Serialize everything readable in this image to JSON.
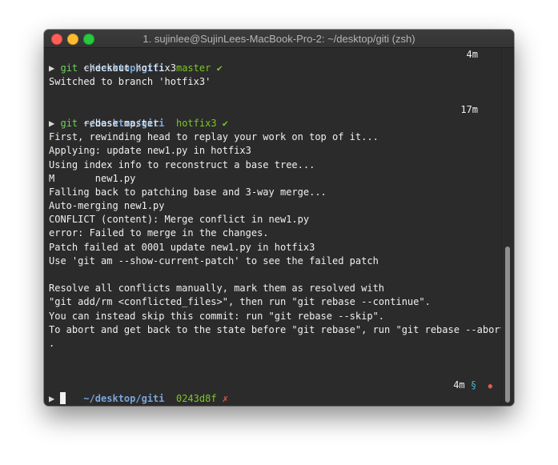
{
  "window": {
    "title": "1. sujinlee@SujinLees-MacBook-Pro-2: ~/desktop/giti (zsh)"
  },
  "prompt1": {
    "dir": "~/desktop/giti",
    "branch": "master",
    "status": "✔",
    "time": "4m",
    "arrow": "▶",
    "cmd": "git",
    "args": "checkout hotfix3"
  },
  "output1": [
    "Switched to branch 'hotfix3'"
  ],
  "prompt2": {
    "dir": "~/desktop/giti",
    "branch": "hotfix3",
    "status": "✔",
    "time": "17m",
    "arrow": "▶",
    "cmd": "git",
    "args": "rebase master"
  },
  "output2": [
    "First, rewinding head to replay your work on top of it...",
    "Applying: update new1.py in hotfix3",
    "Using index info to reconstruct a base tree...",
    "M       new1.py",
    "Falling back to patching base and 3-way merge...",
    "Auto-merging new1.py",
    "CONFLICT (content): Merge conflict in new1.py",
    "error: Failed to merge in the changes.",
    "Patch failed at 0001 update new1.py in hotfix3",
    "Use 'git am --show-current-patch' to see the failed patch",
    "",
    "Resolve all conflicts manually, mark them as resolved with",
    "\"git add/rm <conflicted_files>\", then run \"git rebase --continue\".",
    "You can instead skip this commit: run \"git rebase --skip\".",
    "To abort and get back to the state before \"git rebase\", run \"git rebase --abort\"",
    "."
  ],
  "prompt3": {
    "dir": "~/desktop/giti",
    "branch": "0243d8f",
    "status": "✗",
    "time": "4m",
    "section_sign": "§",
    "marker": "␡",
    "arrow": "▶"
  },
  "colors": {
    "dir": "#7aa6da",
    "branch": "#7cc629",
    "error": "#e55b45",
    "accent": "#3fb7c9"
  }
}
